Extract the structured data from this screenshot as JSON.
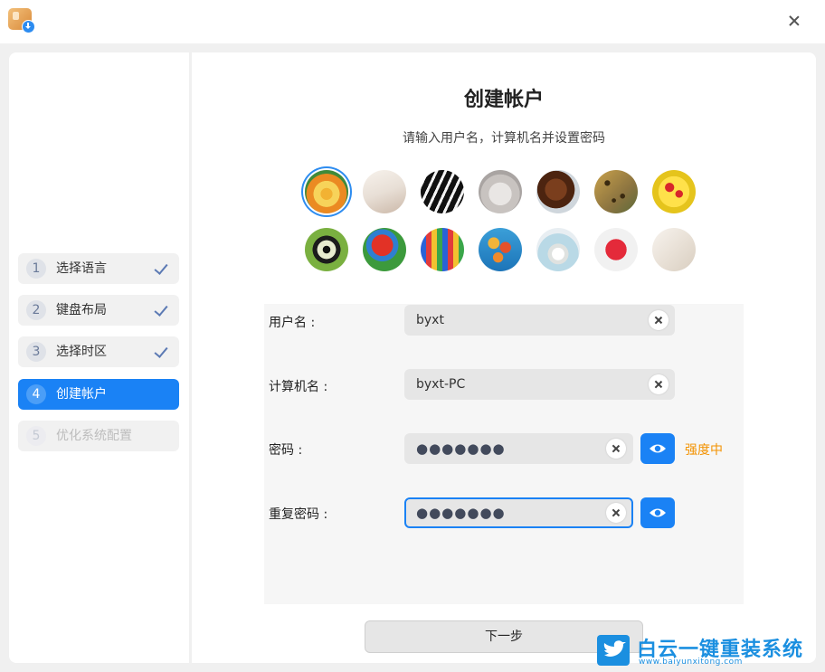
{
  "window": {
    "close_icon": "close-icon",
    "app_icon": "installer-package-icon"
  },
  "sidebar": {
    "steps": [
      {
        "num": "1",
        "label": "选择语言",
        "state": "done"
      },
      {
        "num": "2",
        "label": "键盘布局",
        "state": "done"
      },
      {
        "num": "3",
        "label": "选择时区",
        "state": "done"
      },
      {
        "num": "4",
        "label": "创建帐户",
        "state": "active"
      },
      {
        "num": "5",
        "label": "优化系统配置",
        "state": "disabled"
      }
    ]
  },
  "main": {
    "title": "创建帐户",
    "subtitle": "请输入用户名，计算机名并设置密码",
    "avatars": [
      "flower",
      "sheet-music",
      "piano-keys",
      "kitten",
      "horse",
      "leopard",
      "ladybug",
      "butterfly",
      "parrot",
      "hot-air-balloon",
      "balloons",
      "rings",
      "heart",
      "room"
    ],
    "selected_avatar": "flower",
    "form": {
      "username": {
        "label": "用户名 :",
        "value": "byxt"
      },
      "computer_name": {
        "label": "计算机名 :",
        "value": "byxt-PC"
      },
      "password": {
        "label": "密码 :",
        "value": "●●●●●●●",
        "strength": "强度中"
      },
      "repeat_password": {
        "label": "重复密码 :",
        "value": "●●●●●●●"
      }
    },
    "next_button": "下一步"
  },
  "watermark": {
    "text": "白云一键重装系统",
    "url": "www.baiyunxitong.com"
  },
  "colors": {
    "accent": "#1a82f5",
    "strength": "#f39200"
  }
}
